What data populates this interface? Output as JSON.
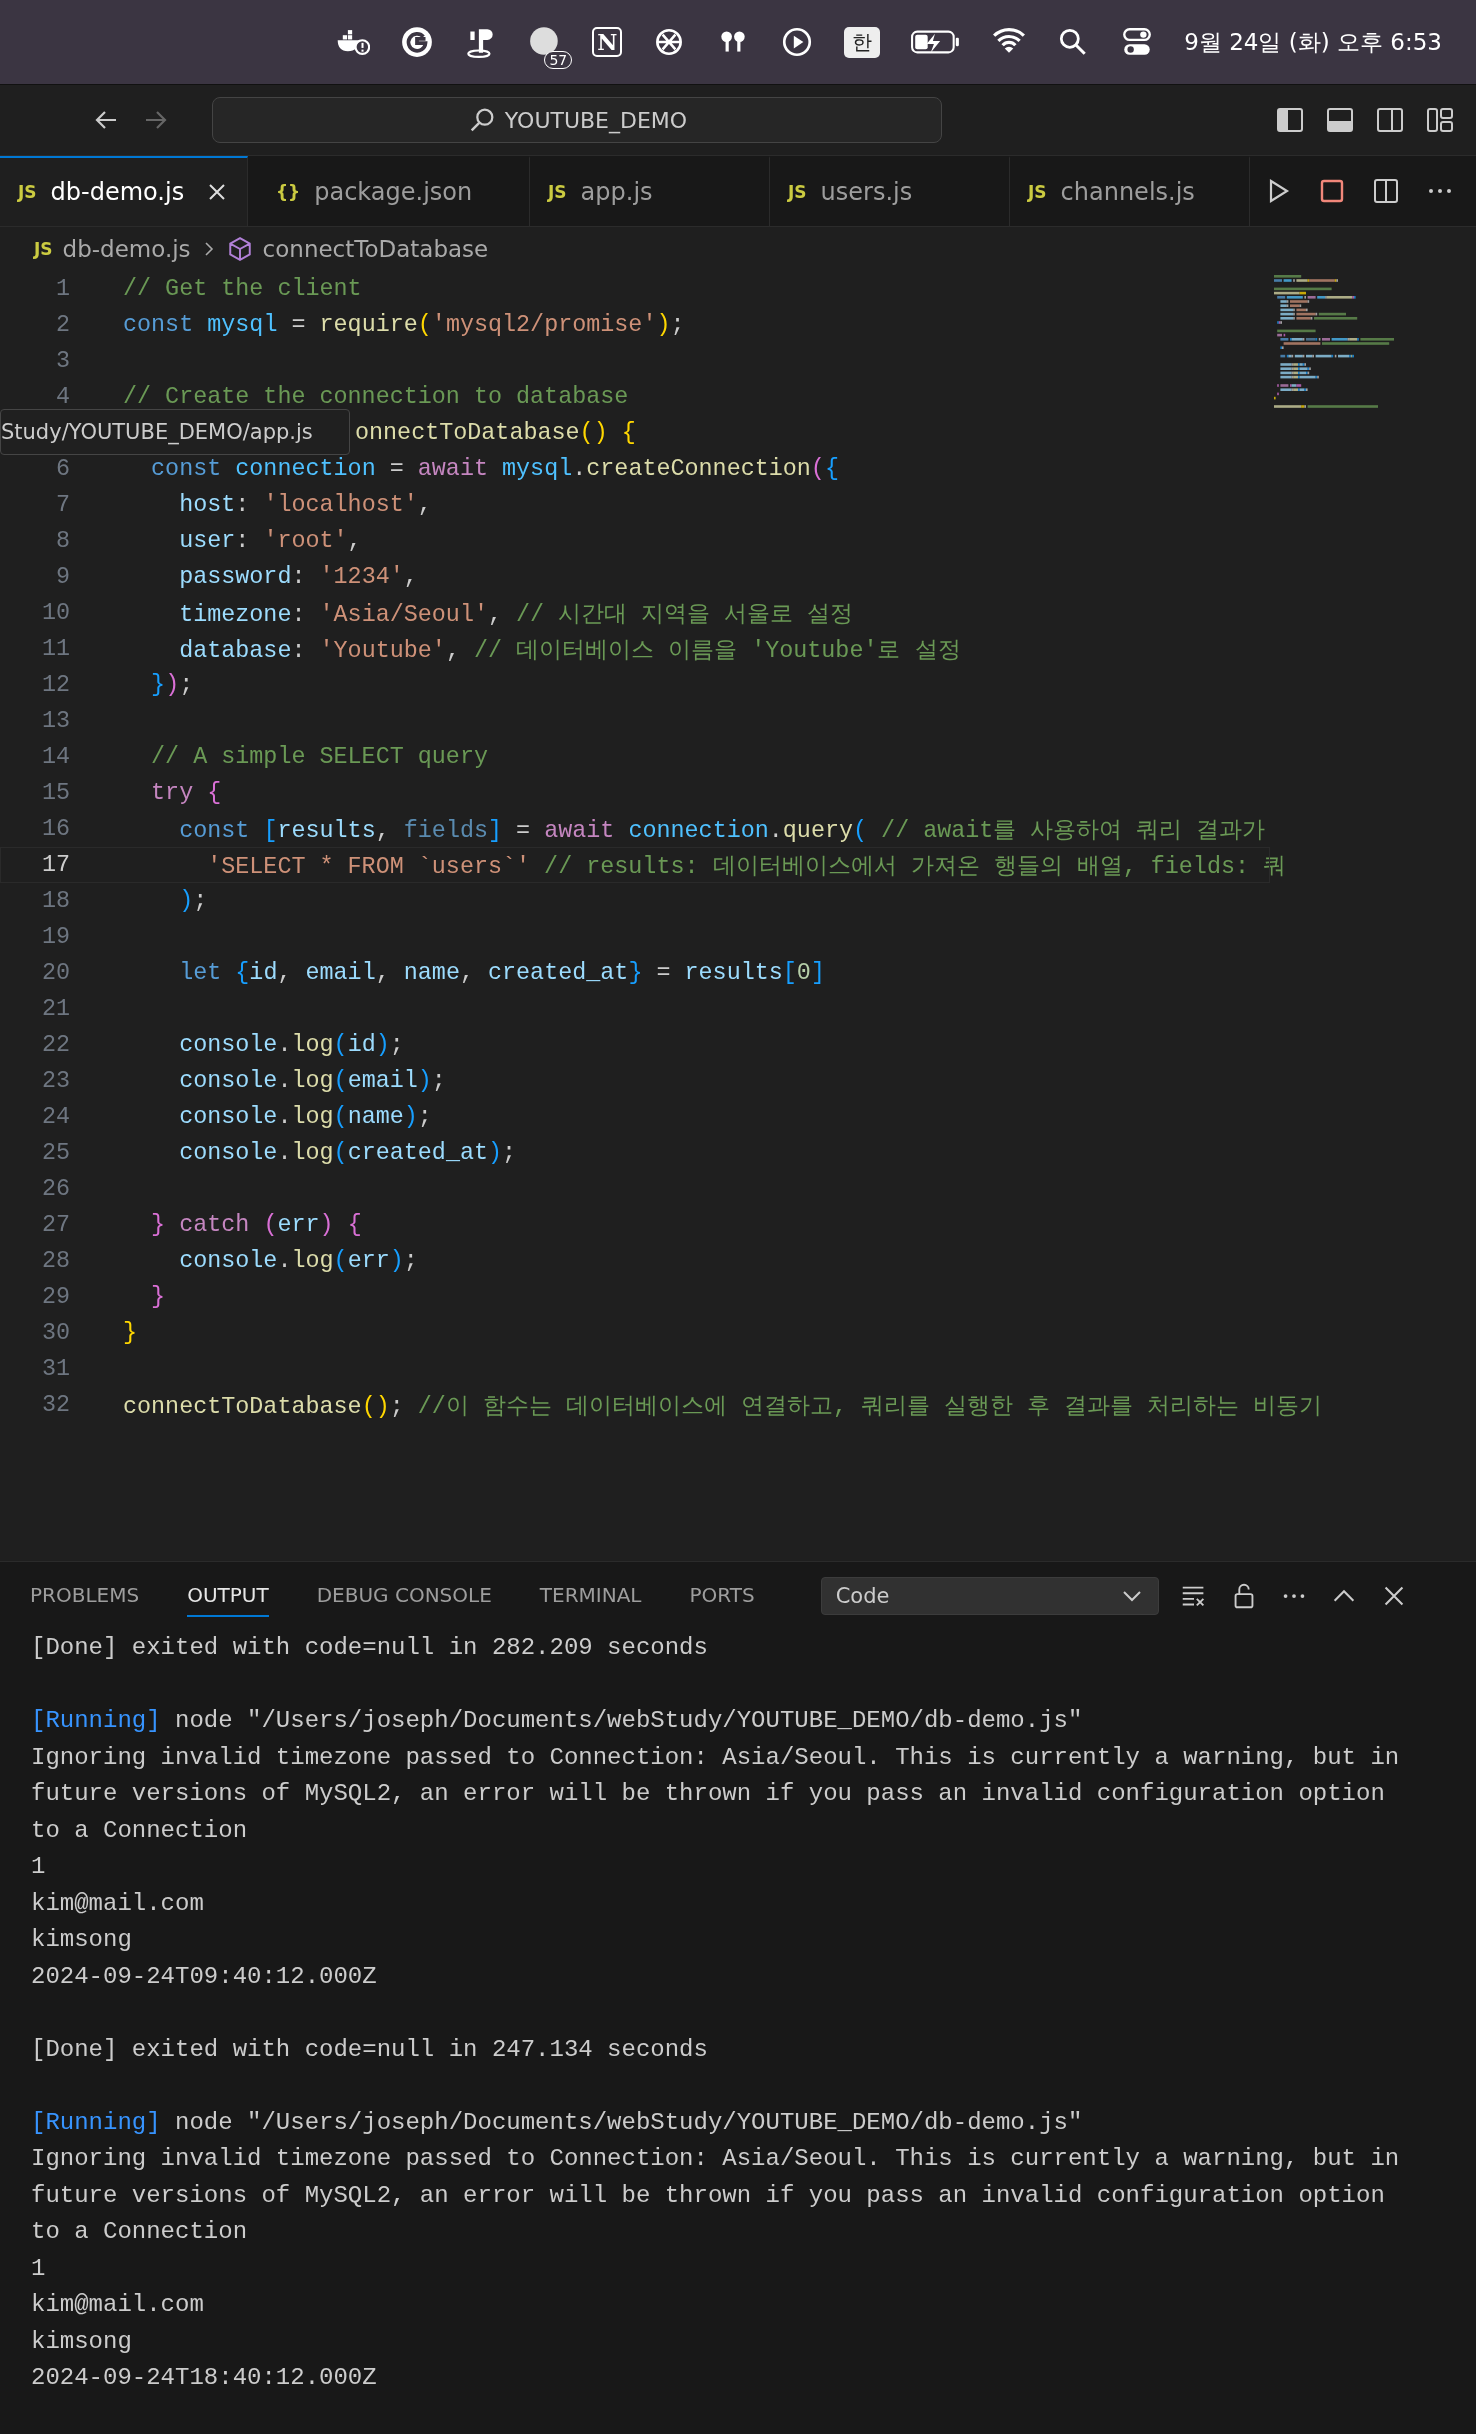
{
  "menu_bar": {
    "badge_count": "57",
    "notion_letter": "N",
    "input_source": "한",
    "clock": "9월 24일 (화) 오후 6:53"
  },
  "title_bar": {
    "search": "YOUTUBE_DEMO",
    "forward_disabled": true
  },
  "tabs": [
    {
      "icon": "JS",
      "label": "db-demo.js",
      "selected": true
    },
    {
      "icon": "{}",
      "label": "package.json",
      "selected": false
    },
    {
      "icon": "JS",
      "label": "app.js",
      "selected": false
    },
    {
      "icon": "JS",
      "label": "users.js",
      "selected": false
    },
    {
      "icon": "JS",
      "label": "channels.js",
      "selected": false
    }
  ],
  "breadcrumb": {
    "file_icon": "JS",
    "file": "db-demo.js",
    "symbol": "connectToDatabase"
  },
  "tooltip": "Study/YOUTUBE_DEMO/app.js",
  "code": [
    {
      "number": "1",
      "tokens": [
        {
          "kind": "comment",
          "text": "// Get the client"
        }
      ]
    },
    {
      "number": "2",
      "tokens": [
        {
          "kind": "keyword",
          "text": "const "
        },
        {
          "kind": "constant",
          "text": "mysql"
        },
        {
          "kind": "punctuation",
          "text": " = "
        },
        {
          "kind": "function",
          "text": "require"
        },
        {
          "kind": "bracket1",
          "text": "("
        },
        {
          "kind": "string",
          "text": "'mysql2/promise'"
        },
        {
          "kind": "bracket1",
          "text": ")"
        },
        {
          "kind": "punctuation",
          "text": ";"
        }
      ]
    },
    {
      "number": "3"
    },
    {
      "number": "4",
      "tokens": [
        {
          "kind": "comment",
          "text": "// Create the connection to database"
        }
      ]
    },
    {
      "covered": true,
      "tokens": [
        {
          "kind": "function",
          "text": "onnectToDatabase"
        },
        {
          "kind": "bracket1",
          "text": "() {"
        }
      ]
    },
    {
      "number": "6",
      "tokens": [
        {
          "kind": "keyword",
          "text": "  const "
        },
        {
          "kind": "constant",
          "text": "connection"
        },
        {
          "kind": "punctuation",
          "text": " = "
        },
        {
          "kind": "control",
          "text": "await "
        },
        {
          "kind": "constant",
          "text": "mysql"
        },
        {
          "kind": "punctuation",
          "text": "."
        },
        {
          "kind": "function",
          "text": "createConnection"
        },
        {
          "kind": "bracket2",
          "text": "("
        },
        {
          "kind": "bracket3",
          "text": "{"
        }
      ]
    },
    {
      "number": "7",
      "tokens": [
        {
          "kind": "variable",
          "text": "    host"
        },
        {
          "kind": "punctuation",
          "text": ": "
        },
        {
          "kind": "string",
          "text": "'localhost'"
        },
        {
          "kind": "punctuation",
          "text": ","
        }
      ]
    },
    {
      "number": "8",
      "tokens": [
        {
          "kind": "variable",
          "text": "    user"
        },
        {
          "kind": "punctuation",
          "text": ": "
        },
        {
          "kind": "string",
          "text": "'root'"
        },
        {
          "kind": "punctuation",
          "text": ","
        }
      ]
    },
    {
      "number": "9",
      "tokens": [
        {
          "kind": "variable",
          "text": "    password"
        },
        {
          "kind": "punctuation",
          "text": ": "
        },
        {
          "kind": "string",
          "text": "'1234'"
        },
        {
          "kind": "punctuation",
          "text": ","
        }
      ]
    },
    {
      "number": "10",
      "tokens": [
        {
          "kind": "variable",
          "text": "    timezone"
        },
        {
          "kind": "punctuation",
          "text": ": "
        },
        {
          "kind": "string",
          "text": "'Asia/Seoul'"
        },
        {
          "kind": "punctuation",
          "text": ", "
        },
        {
          "kind": "comment",
          "text": "// 시간대 지역을 서울로 설정"
        }
      ]
    },
    {
      "number": "11",
      "tokens": [
        {
          "kind": "variable",
          "text": "    database"
        },
        {
          "kind": "punctuation",
          "text": ": "
        },
        {
          "kind": "string",
          "text": "'Youtube'"
        },
        {
          "kind": "punctuation",
          "text": ", "
        },
        {
          "kind": "comment",
          "text": "// 데이터베이스 이름을 'Youtube'로 설정"
        }
      ]
    },
    {
      "number": "12",
      "tokens": [
        {
          "kind": "bracket3",
          "text": "  }"
        },
        {
          "kind": "bracket2",
          "text": ")"
        },
        {
          "kind": "punctuation",
          "text": ";"
        }
      ]
    },
    {
      "number": "13"
    },
    {
      "number": "14",
      "tokens": [
        {
          "kind": "comment",
          "text": "  // A simple SELECT query"
        }
      ]
    },
    {
      "number": "15",
      "tokens": [
        {
          "kind": "control",
          "text": "  try "
        },
        {
          "kind": "bracket2",
          "text": "{"
        }
      ]
    },
    {
      "number": "16",
      "tokens": [
        {
          "kind": "keyword",
          "text": "    const "
        },
        {
          "kind": "bracket3",
          "text": "["
        },
        {
          "kind": "variable",
          "text": "results"
        },
        {
          "kind": "punctuation",
          "text": ", "
        },
        {
          "kind": "unused",
          "text": "fields"
        },
        {
          "kind": "bracket3",
          "text": "]"
        },
        {
          "kind": "punctuation",
          "text": " = "
        },
        {
          "kind": "control",
          "text": "await "
        },
        {
          "kind": "constant",
          "text": "connection"
        },
        {
          "kind": "punctuation",
          "text": "."
        },
        {
          "kind": "function",
          "text": "query"
        },
        {
          "kind": "bracket3",
          "text": "( "
        },
        {
          "kind": "comment",
          "text": "// await를 사용하여 쿼리 결과가"
        }
      ]
    },
    {
      "number": "17",
      "current": true,
      "tokens": [
        {
          "kind": "string",
          "text": "      'SELECT * FROM `users`'"
        },
        {
          "kind": "comment",
          "text": " // results: 데이터베이스에서 가져온 행들의 배열, fields: 쿼"
        }
      ]
    },
    {
      "number": "18",
      "tokens": [
        {
          "kind": "bracket3",
          "text": "    )"
        },
        {
          "kind": "punctuation",
          "text": ";"
        }
      ]
    },
    {
      "number": "19"
    },
    {
      "number": "20",
      "tokens": [
        {
          "kind": "keyword",
          "text": "    let "
        },
        {
          "kind": "bracket3",
          "text": "{"
        },
        {
          "kind": "variable",
          "text": "id"
        },
        {
          "kind": "punctuation",
          "text": ", "
        },
        {
          "kind": "variable",
          "text": "email"
        },
        {
          "kind": "punctuation",
          "text": ", "
        },
        {
          "kind": "variable",
          "text": "name"
        },
        {
          "kind": "punctuation",
          "text": ", "
        },
        {
          "kind": "variable",
          "text": "created_at"
        },
        {
          "kind": "bracket3",
          "text": "}"
        },
        {
          "kind": "punctuation",
          "text": " = "
        },
        {
          "kind": "variable",
          "text": "results"
        },
        {
          "kind": "bracket3",
          "text": "["
        },
        {
          "kind": "number",
          "text": "0"
        },
        {
          "kind": "bracket3",
          "text": "]"
        }
      ]
    },
    {
      "number": "21"
    },
    {
      "number": "22",
      "tokens": [
        {
          "kind": "variable",
          "text": "    console"
        },
        {
          "kind": "punctuation",
          "text": "."
        },
        {
          "kind": "function",
          "text": "log"
        },
        {
          "kind": "bracket3",
          "text": "("
        },
        {
          "kind": "variable",
          "text": "id"
        },
        {
          "kind": "bracket3",
          "text": ")"
        },
        {
          "kind": "punctuation",
          "text": ";"
        }
      ]
    },
    {
      "number": "23",
      "tokens": [
        {
          "kind": "variable",
          "text": "    console"
        },
        {
          "kind": "punctuation",
          "text": "."
        },
        {
          "kind": "function",
          "text": "log"
        },
        {
          "kind": "bracket3",
          "text": "("
        },
        {
          "kind": "variable",
          "text": "email"
        },
        {
          "kind": "bracket3",
          "text": ")"
        },
        {
          "kind": "punctuation",
          "text": ";"
        }
      ]
    },
    {
      "number": "24",
      "tokens": [
        {
          "kind": "variable",
          "text": "    console"
        },
        {
          "kind": "punctuation",
          "text": "."
        },
        {
          "kind": "function",
          "text": "log"
        },
        {
          "kind": "bracket3",
          "text": "("
        },
        {
          "kind": "variable",
          "text": "name"
        },
        {
          "kind": "bracket3",
          "text": ")"
        },
        {
          "kind": "punctuation",
          "text": ";"
        }
      ]
    },
    {
      "number": "25",
      "tokens": [
        {
          "kind": "variable",
          "text": "    console"
        },
        {
          "kind": "punctuation",
          "text": "."
        },
        {
          "kind": "function",
          "text": "log"
        },
        {
          "kind": "bracket3",
          "text": "("
        },
        {
          "kind": "variable",
          "text": "created_at"
        },
        {
          "kind": "bracket3",
          "text": ")"
        },
        {
          "kind": "punctuation",
          "text": ";"
        }
      ]
    },
    {
      "number": "26"
    },
    {
      "number": "27",
      "tokens": [
        {
          "kind": "bracket2",
          "text": "  } "
        },
        {
          "kind": "control",
          "text": "catch "
        },
        {
          "kind": "bracket2",
          "text": "("
        },
        {
          "kind": "variable",
          "text": "err"
        },
        {
          "kind": "bracket2",
          "text": ") {"
        }
      ]
    },
    {
      "number": "28",
      "tokens": [
        {
          "kind": "variable",
          "text": "    console"
        },
        {
          "kind": "punctuation",
          "text": "."
        },
        {
          "kind": "function",
          "text": "log"
        },
        {
          "kind": "bracket3",
          "text": "("
        },
        {
          "kind": "variable",
          "text": "err"
        },
        {
          "kind": "bracket3",
          "text": ")"
        },
        {
          "kind": "punctuation",
          "text": ";"
        }
      ]
    },
    {
      "number": "29",
      "tokens": [
        {
          "kind": "bracket2",
          "text": "  }"
        }
      ]
    },
    {
      "number": "30",
      "tokens": [
        {
          "kind": "bracket1",
          "text": "}"
        }
      ]
    },
    {
      "number": "31"
    },
    {
      "number": "32",
      "tokens": [
        {
          "kind": "function",
          "text": "connectToDatabase"
        },
        {
          "kind": "bracket1",
          "text": "()"
        },
        {
          "kind": "punctuation",
          "text": "; "
        },
        {
          "kind": "comment",
          "text": "//이 함수는 데이터베이스에 연결하고, 쿼리를 실행한 후 결과를 처리하는 비동기"
        }
      ]
    }
  ],
  "panel": {
    "tabs": [
      {
        "label": "PROBLEMS",
        "selected": false
      },
      {
        "label": "OUTPUT",
        "selected": true
      },
      {
        "label": "DEBUG CONSOLE",
        "selected": false
      },
      {
        "label": "TERMINAL",
        "selected": false
      },
      {
        "label": "PORTS",
        "selected": false
      }
    ],
    "dropdown": "Code",
    "output": [
      {
        "kind": "done",
        "lines": [
          "[Done] exited with code=null in 282.209 seconds"
        ]
      },
      {
        "kind": "run",
        "tag": "[Running]",
        "command": "node \"/Users/joseph/Documents/webStudy/YOUTUBE_DEMO/db-demo.js\"",
        "lines": [
          "Ignoring invalid timezone passed to Connection: Asia/Seoul. This is currently a warning, but in",
          "future versions of MySQL2, an error will be thrown if you pass an invalid configuration option",
          "to a Connection",
          "1",
          "kim@mail.com",
          "kimsong",
          "2024-09-24T09:40:12.000Z"
        ]
      },
      {
        "kind": "done",
        "lines": [
          "[Done] exited with code=null in 247.134 seconds"
        ]
      },
      {
        "kind": "run",
        "tag": "[Running]",
        "command": "node \"/Users/joseph/Documents/webStudy/YOUTUBE_DEMO/db-demo.js\"",
        "lines": [
          "Ignoring invalid timezone passed to Connection: Asia/Seoul. This is currently a warning, but in",
          "future versions of MySQL2, an error will be thrown if you pass an invalid configuration option",
          "to a Connection",
          "1",
          "kim@mail.com",
          "kimsong",
          "2024-09-24T18:40:12.000Z"
        ]
      }
    ]
  }
}
